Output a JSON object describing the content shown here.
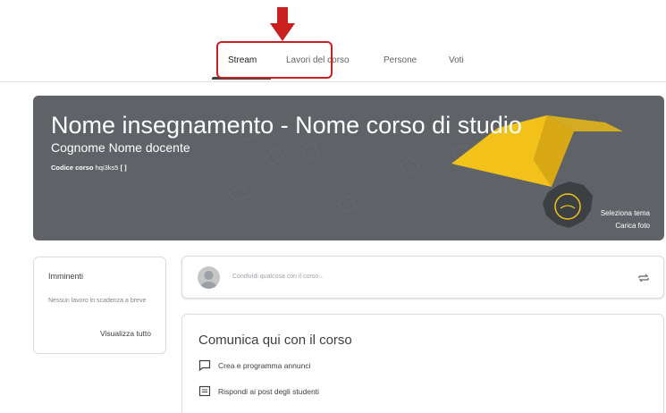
{
  "tabs": [
    {
      "label": "Stream",
      "active": true
    },
    {
      "label": "Lavori del corso",
      "active": false
    },
    {
      "label": "Persone",
      "active": false
    },
    {
      "label": "Voti",
      "active": false
    }
  ],
  "banner": {
    "title": "Nome insegnamento - Nome corso di studio",
    "subtitle": "Cognome Nome docente",
    "code_label": "Codice corso",
    "code_value": "hqi3ks5",
    "select_theme": "Seleziona tema",
    "upload_photo": "Carica foto",
    "background_color": "#5f6368",
    "accent_color": "#f2c21b"
  },
  "upcoming": {
    "title": "Imminenti",
    "text": "Nessun lavoro in scadenza a breve",
    "link": "Visualizza tutto"
  },
  "share": {
    "placeholder": "Condividi qualcosa con il corso..."
  },
  "communicate": {
    "title": "Comunica qui con il corso",
    "items": [
      {
        "icon": "announcement-icon",
        "label": "Crea e programma annunci"
      },
      {
        "icon": "reply-icon",
        "label": "Rispondi ai post degli studenti"
      }
    ]
  },
  "highlight_color": "#c9201f"
}
